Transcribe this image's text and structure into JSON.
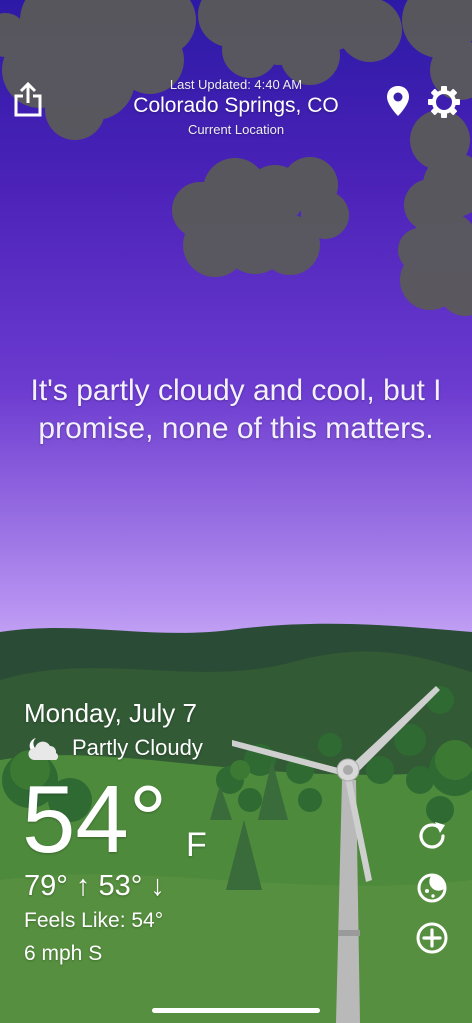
{
  "header": {
    "last_updated": "Last Updated: 4:40 AM",
    "city": "Colorado Springs, CO",
    "location_label": "Current Location"
  },
  "message": "It's partly cloudy and cool, but I promise, none of this matters.",
  "weather": {
    "date": "Monday, July 7",
    "condition": "Partly Cloudy",
    "temperature": "54°",
    "unit": "F",
    "hi_lo": "79° ↑  53° ↓",
    "feels_like": "Feels Like: 54°",
    "wind": "6 mph S"
  },
  "icons": {
    "share": "share-icon",
    "location": "map-pin-icon",
    "settings": "gear-icon",
    "condition": "partly-cloudy-night-icon",
    "refresh": "refresh-icon",
    "theme": "cookie-icon",
    "add": "plus-circle-icon"
  },
  "colors": {
    "sky_top": "#2c1aa6",
    "sky_bottom": "#c0a0f3",
    "cloud": "#555555",
    "hills": "#2f5a35",
    "grass": "#4f8a3c"
  }
}
